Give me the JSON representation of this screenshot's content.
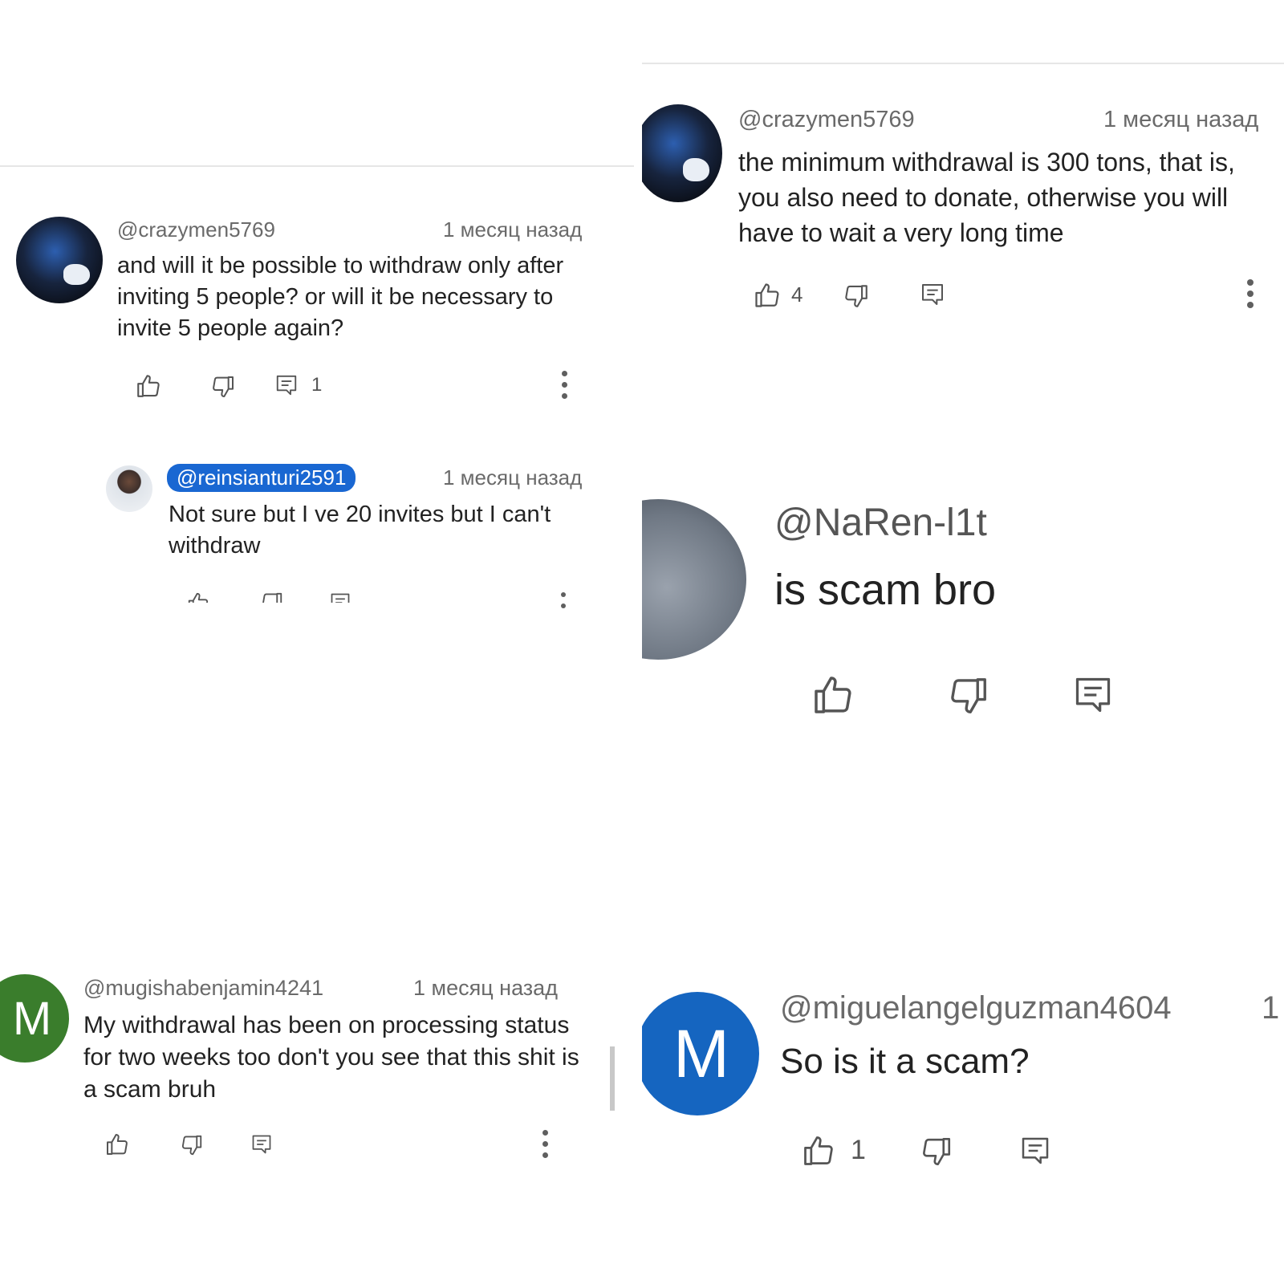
{
  "comments": [
    {
      "handle": "@crazymen5769",
      "time": "1 месяц назад",
      "text": "and will it be possible to withdraw only after inviting 5 people? or will it be necessary to invite 5 people again?",
      "reply_count": "1"
    },
    {
      "handle": "@reinsianturi2591",
      "time": "1 месяц назад",
      "text": "Not sure but I ve 20 invites but I can't withdraw"
    },
    {
      "handle": "@mugishabenjamin4241",
      "avatar_letter": "M",
      "avatar_color": "#3a7d2c",
      "time": "1 месяц назад",
      "text": "My withdrawal  has been on processing status for two weeks too don't you see that this shit is a scam bruh"
    },
    {
      "handle": "@crazymen5769",
      "time": "1 месяц назад",
      "text": "the minimum withdrawal is 300 tons, that is, you also need to donate, otherwise you will have to wait a very long time",
      "like_count": "4"
    },
    {
      "handle": "@NaRen-l1t",
      "text": "is scam bro"
    },
    {
      "handle": "@miguelangelguzman4604",
      "avatar_letter": "M",
      "avatar_color": "#1565c0",
      "time_partial": "1",
      "text": "So is it a scam?",
      "like_count": "1"
    }
  ],
  "colors": {
    "chip": "#1967d2",
    "divider": "#e6e6e6"
  },
  "icons": [
    "thumbs-up-icon",
    "thumbs-down-icon",
    "reply-icon",
    "more-vert-icon"
  ]
}
